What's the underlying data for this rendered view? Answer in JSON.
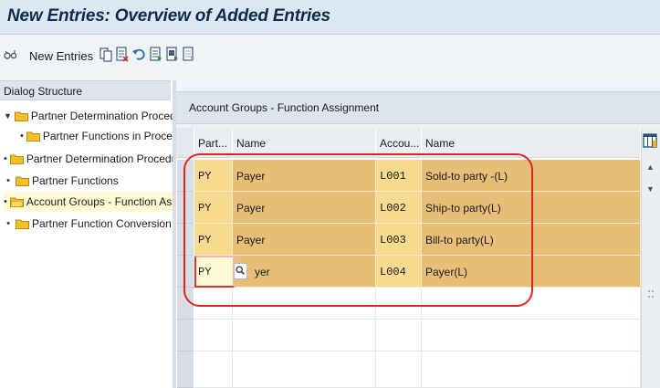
{
  "window": {
    "title": "New Entries: Overview of Added Entries"
  },
  "toolbar": {
    "new_entries_label": "New Entries",
    "icons": [
      "glasses-icon",
      "copy-icon",
      "delete-icon",
      "undo-icon",
      "select-all-icon",
      "select-block-icon",
      "deselect-all-icon"
    ]
  },
  "dialog_structure": {
    "header": "Dialog Structure",
    "items": [
      {
        "label": "Partner Determination Procedure",
        "expanded": true,
        "level": 0
      },
      {
        "label": "Partner Functions in Procedure",
        "level": 1
      },
      {
        "label": "Partner Determination Procedure",
        "level": 0
      },
      {
        "label": "Partner Functions",
        "level": 0
      },
      {
        "label": "Account Groups - Function Assignment",
        "level": 0,
        "selected": true
      },
      {
        "label": "Partner Function Conversion",
        "level": 0
      }
    ]
  },
  "panel": {
    "title": "Account Groups - Function Assignment",
    "columns": [
      "Part...",
      "Name",
      "Accou...",
      "Name"
    ],
    "rows": [
      {
        "partner_function": "PY",
        "name": "Payer",
        "account_group": "L001",
        "group_name": "Sold-to party -(L)"
      },
      {
        "partner_function": "PY",
        "name": "Payer",
        "account_group": "L002",
        "group_name": "Ship-to party(L)"
      },
      {
        "partner_function": "PY",
        "name": "Payer",
        "account_group": "L003",
        "group_name": "Bill-to party(L)"
      },
      {
        "partner_function": "PY",
        "name": "yer",
        "account_group": "L004",
        "group_name": "Payer(L)"
      }
    ]
  },
  "colors": {
    "key_cell": "#f7d98f",
    "data_cell": "#e7be77",
    "annotation": "#e0241f"
  }
}
